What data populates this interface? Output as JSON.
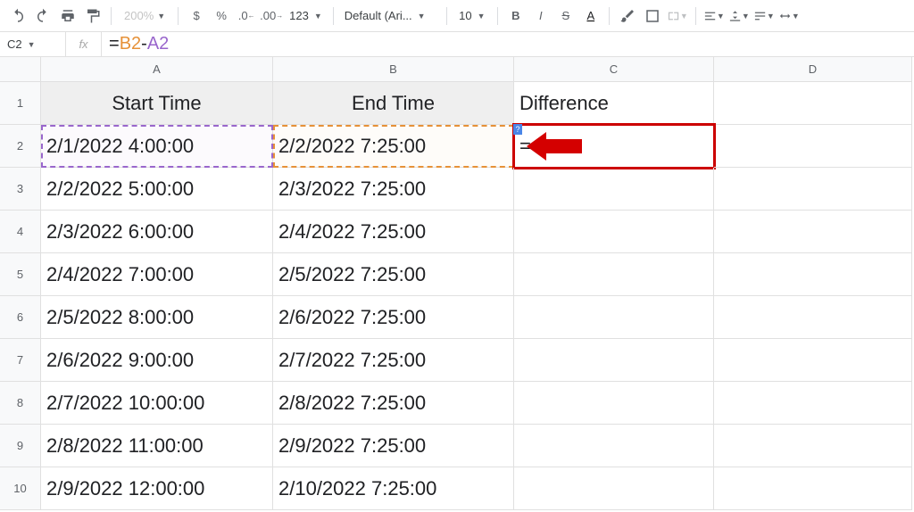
{
  "toolbar": {
    "zoom": "200%",
    "format_123": "123",
    "font": "Default (Ari...",
    "font_size": "10"
  },
  "formula_bar": {
    "cell_ref": "C2",
    "fx": "fx",
    "eq": "=",
    "ref1": "B2",
    "minus": "-",
    "ref2": "A2"
  },
  "columns": [
    "A",
    "B",
    "C",
    "D"
  ],
  "headers": {
    "a": "Start Time",
    "b": "End Time",
    "c": "Difference"
  },
  "rows": [
    {
      "n": "1"
    },
    {
      "n": "2",
      "a": "2/1/2022 4:00:00",
      "b": "2/2/2022 7:25:00",
      "c": "="
    },
    {
      "n": "3",
      "a": "2/2/2022 5:00:00",
      "b": "2/3/2022 7:25:00"
    },
    {
      "n": "4",
      "a": "2/3/2022 6:00:00",
      "b": "2/4/2022 7:25:00"
    },
    {
      "n": "5",
      "a": "2/4/2022 7:00:00",
      "b": "2/5/2022 7:25:00"
    },
    {
      "n": "6",
      "a": "2/5/2022 8:00:00",
      "b": "2/6/2022 7:25:00"
    },
    {
      "n": "7",
      "a": "2/6/2022 9:00:00",
      "b": "2/7/2022 7:25:00"
    },
    {
      "n": "8",
      "a": "2/7/2022 10:00:00",
      "b": "2/8/2022 7:25:00"
    },
    {
      "n": "9",
      "a": "2/8/2022 11:00:00",
      "b": "2/9/2022 7:25:00"
    },
    {
      "n": "10",
      "a": "2/9/2022 12:00:00",
      "b": "2/10/2022 7:25:00"
    }
  ],
  "help_badge": "?"
}
